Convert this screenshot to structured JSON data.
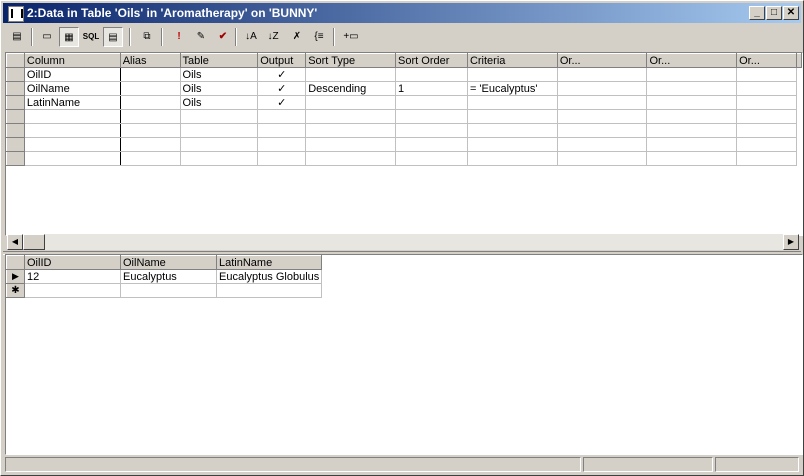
{
  "window": {
    "title": "2:Data in Table 'Oils' in 'Aromatherapy' on 'BUNNY'",
    "minimize_glyph": "_",
    "maximize_glyph": "□",
    "close_glyph": "✕"
  },
  "toolbar": {
    "buttons": [
      {
        "name": "properties-icon",
        "glyph": "▤"
      },
      {
        "name": "diagram-pane-icon",
        "glyph": "▭"
      },
      {
        "name": "grid-pane-icon",
        "glyph": "▦"
      },
      {
        "name": "sql-pane-icon",
        "glyph": "SQL"
      },
      {
        "name": "results-pane-icon",
        "glyph": "▤"
      },
      {
        "name": "change-type-icon",
        "glyph": "⧉"
      },
      {
        "name": "run-icon",
        "glyph": "!"
      },
      {
        "name": "clear-results-icon",
        "glyph": "✎"
      },
      {
        "name": "verify-sql-icon",
        "glyph": "✔"
      },
      {
        "name": "sort-ascending-icon",
        "glyph": "↓A"
      },
      {
        "name": "sort-descending-icon",
        "glyph": "↓Z"
      },
      {
        "name": "remove-filter-icon",
        "glyph": "✗"
      },
      {
        "name": "group-by-icon",
        "glyph": "{≡"
      },
      {
        "name": "add-table-icon",
        "glyph": "+▭"
      }
    ]
  },
  "criteria_grid": {
    "headers": [
      "Column",
      "Alias",
      "Table",
      "Output",
      "Sort Type",
      "Sort Order",
      "Criteria",
      "Or...",
      "Or...",
      "Or..."
    ],
    "rows": [
      [
        "OilID",
        "",
        "Oils",
        "✓",
        "",
        "",
        "",
        "",
        "",
        ""
      ],
      [
        "OilName",
        "",
        "Oils",
        "✓",
        "Descending",
        "1",
        "= 'Eucalyptus'",
        "",
        "",
        ""
      ],
      [
        "LatinName",
        "",
        "Oils",
        "✓",
        "",
        "",
        "",
        "",
        "",
        ""
      ]
    ],
    "empty_rows": 4
  },
  "results_grid": {
    "headers": [
      "OilID",
      "OilName",
      "LatinName"
    ],
    "rows": [
      [
        "12",
        "Eucalyptus",
        "Eucalyptus Globulus"
      ]
    ],
    "current_row_glyph": "▶",
    "new_row_glyph": "✱"
  },
  "scrollbar": {
    "left_glyph": "◀",
    "right_glyph": "▶"
  },
  "colors": {
    "title_start": "#0a246a",
    "title_end": "#a6caf0",
    "face": "#d4d0c8"
  }
}
